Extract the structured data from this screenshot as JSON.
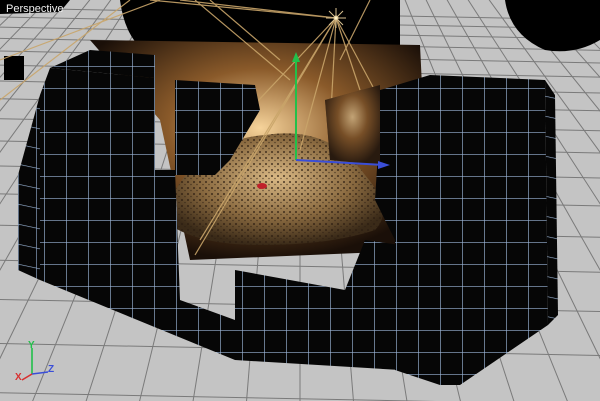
{
  "viewport": {
    "label": "Perspective"
  },
  "axes": {
    "y": {
      "label": "Y",
      "color": "#22c04a"
    },
    "x": {
      "label": "X",
      "color": "#d83030"
    },
    "z": {
      "label": "Z",
      "color": "#3a4ed8"
    }
  },
  "colors": {
    "floor": "#c4c4c4",
    "floor_grid": "#7a7a7a",
    "wall": "#050505",
    "wall_grid": "#9bb6d8",
    "light_cone": "#c9a56a",
    "gizmo_y": "#22c04a",
    "gizmo_x": "#3a4ed8",
    "sand": "#b89868"
  },
  "icons": {
    "light": "light-star-icon",
    "gizmo": "transform-gizmo-icon"
  }
}
